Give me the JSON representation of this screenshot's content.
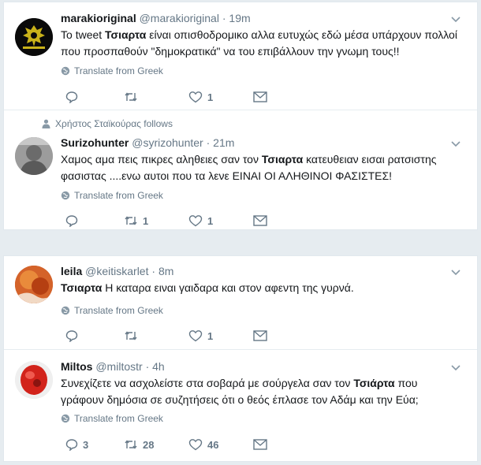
{
  "tweets": [
    {
      "name": "marakioriginal",
      "handle": "@marakioriginal",
      "sep": "·",
      "time": "19m",
      "text_before": "Το tweet ",
      "text_bold": "Τσιαρτα",
      "text_after": " είναι οπισθοδρομικο αλλα ευτυχώς εδώ μέσα υπάρχουν πολλοί που προσπαθούν \"δημοκρατικά\" να του επιβάλλουν την γνωμη τους!!",
      "translate": "Translate from Greek",
      "replies": "",
      "retweets": "",
      "likes": "1"
    },
    {
      "follows": "Χρήστος Σταϊκούρας follows",
      "name": "Surizohunter",
      "handle": "@syrizohunter",
      "sep": "·",
      "time": "21m",
      "text_before": "Χαμος αμα πεις πικρες αληθειες σαν τον ",
      "text_bold": "Τσιαρτα",
      "text_after": " κατευθειαν εισαι ρατσιστης φασιστας ....ενω αυτοι που τα λενε ΕΙΝΑΙ ΟΙ ΑΛΗΘΙΝΟΙ ΦΑΣΙΣΤΕΣ!",
      "translate": "Translate from Greek",
      "replies": "",
      "retweets": "1",
      "likes": "1"
    },
    {
      "name": "leila",
      "handle": "@keitiskarlet",
      "sep": "·",
      "time": "8m",
      "text_before": "",
      "text_bold": "Τσιαρτα",
      "text_after": " Η καταρα ειναι γαιδαρα και στον αφεντη της γυρνά.",
      "translate": "Translate from Greek",
      "replies": "",
      "retweets": "",
      "likes": "1"
    },
    {
      "name": "Miltos",
      "handle": "@miltostr",
      "sep": "·",
      "time": "4h",
      "text_before": "Συνεχίζετε να ασχολείστε στα σοβαρά με σούργελα σαν τον ",
      "text_bold": "Τσιάρτα",
      "text_after": " που γράφουν δημόσια σε συζητήσεις ότι ο θεός έπλασε τον Αδάμ και την Εύα;",
      "translate": "Translate from Greek",
      "replies": "3",
      "retweets": "28",
      "likes": "46"
    }
  ],
  "colors": {
    "background": "#e6ecf0",
    "text": "#14171a",
    "muted": "#657786",
    "border": "#e1e8ed"
  }
}
